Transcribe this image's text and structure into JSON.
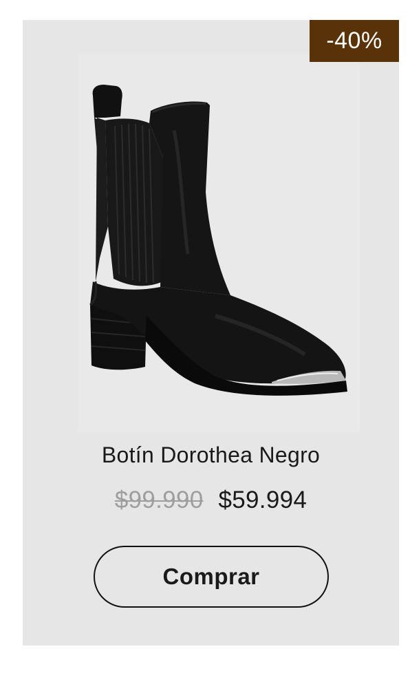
{
  "product": {
    "discount_badge": "-40%",
    "image_alt": "boot-image",
    "name": "Botín Dorothea Negro",
    "original_price": "$99.990",
    "sale_price": "$59.994",
    "buy_label": "Comprar"
  },
  "colors": {
    "card_bg": "#e6e6e6",
    "badge_bg": "#5a3208",
    "badge_text": "#ffffff",
    "old_price": "#9e9e9e",
    "text": "#1a1a1a"
  }
}
